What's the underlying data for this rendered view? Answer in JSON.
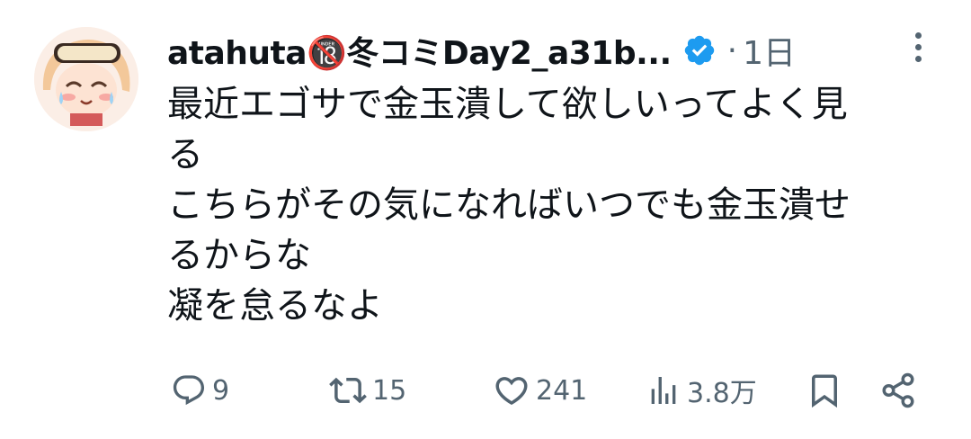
{
  "tweet": {
    "display_name": "atahuta🔞冬コミDay2_a31b...",
    "time_separator": "·",
    "time": "1日",
    "text_lines": [
      "最近エゴサで金玉潰して欲しいってよく見",
      "る",
      "こちらがその気になればいつでも金玉潰せ",
      "るからな",
      "凝を怠るなよ"
    ]
  },
  "actions": {
    "reply_count": "9",
    "retweet_count": "15",
    "like_count": "241",
    "views_count": "3.8万"
  },
  "icons": {
    "verified": "verified-badge-icon",
    "more": "more-vertical-icon",
    "reply": "reply-icon",
    "retweet": "retweet-icon",
    "like": "heart-icon",
    "views": "views-icon",
    "bookmark": "bookmark-icon",
    "share": "share-icon"
  },
  "colors": {
    "text": "#0f1419",
    "secondary": "#536471",
    "verified_blue": "#1d9bf0"
  }
}
